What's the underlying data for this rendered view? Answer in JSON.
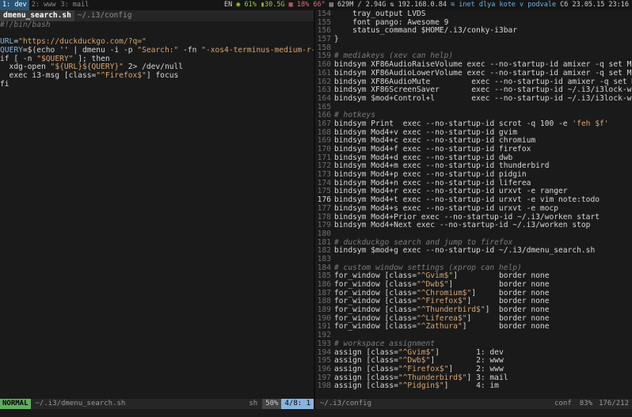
{
  "topbar": {
    "workspaces": [
      {
        "label": "1: dev",
        "active": true
      },
      {
        "label": "2: www",
        "active": false
      },
      {
        "label": "3: mail",
        "active": false
      }
    ],
    "lang": "EN",
    "wifi": "61%",
    "disk": "30.5G",
    "cpu": "18%",
    "temp": "66°",
    "mem": "629M / 2.94G",
    "ip": "192.168.0.84",
    "net": "inet dlya kote v podvale",
    "date": "Сб 23.05.15",
    "time": "23:16"
  },
  "left": {
    "tabs": [
      {
        "label": "dmenu_search.sh",
        "active": true
      },
      {
        "label": "~/.i3/config",
        "active": false
      }
    ],
    "lines": [
      [
        [
          "cmt",
          "#!/bin/bash"
        ]
      ],
      [
        [
          "kw",
          ""
        ]
      ],
      [
        [
          "var",
          "URL"
        ],
        [
          "kw",
          "="
        ],
        [
          "str",
          "\"https://duckduckgo.com/?q=\""
        ]
      ],
      [
        [
          "var",
          "QUERY"
        ],
        [
          "kw",
          "=$(echo '' | dmenu -i -p "
        ],
        [
          "str",
          "\"Search:\""
        ],
        [
          "kw",
          " -fn "
        ],
        [
          "str",
          "\"-xos4-terminus-medium-r-*-*-1"
        ]
      ],
      [
        [
          "kw",
          "if [ -n "
        ],
        [
          "str",
          "\"$QUERY\""
        ],
        [
          "kw",
          " ]; then"
        ]
      ],
      [
        [
          "kw",
          "  xdg-open "
        ],
        [
          "str",
          "\"${URL}${QUERY}\""
        ],
        [
          "kw",
          " 2> /dev/null"
        ]
      ],
      [
        [
          "kw",
          "  exec i3-msg [class="
        ],
        [
          "str",
          "\"^Firefox$\""
        ],
        [
          "kw",
          "] focus"
        ]
      ],
      [
        [
          "kw",
          "fi"
        ]
      ]
    ]
  },
  "right": {
    "lines": [
      {
        "n": "154",
        "parts": [
          [
            "kw",
            "    tray_output LVDS"
          ]
        ]
      },
      {
        "n": "155",
        "parts": [
          [
            "kw",
            "    font pango: Awesome 9"
          ]
        ]
      },
      {
        "n": "156",
        "parts": [
          [
            "kw",
            "    status_command $HOME/.i3/conky-i3bar"
          ]
        ]
      },
      {
        "n": "157",
        "parts": [
          [
            "kw",
            "}"
          ]
        ]
      },
      {
        "n": "158",
        "parts": [
          [
            "kw",
            ""
          ]
        ]
      },
      {
        "n": "159",
        "parts": [
          [
            "cmt",
            "# mediakeys (xev can help)"
          ]
        ]
      },
      {
        "n": "160",
        "parts": [
          [
            "kw",
            "bindsym XF86AudioRaiseVolume exec --no-startup-id amixer -q set Master"
          ]
        ]
      },
      {
        "n": "161",
        "parts": [
          [
            "kw",
            "bindsym XF86AudioLowerVolume exec --no-startup-id amixer -q set Master"
          ]
        ]
      },
      {
        "n": "162",
        "parts": [
          [
            "kw",
            "bindsym XF86AudioMute         exec --no-startup-id amixer -q set Master"
          ]
        ]
      },
      {
        "n": "163",
        "parts": [
          [
            "kw",
            "bindsym XF86ScreenSaver       exec --no-startup-id ~/.i3/i3lock-wrapper"
          ]
        ]
      },
      {
        "n": "164",
        "parts": [
          [
            "kw",
            "bindsym $mod+Control+l        exec --no-startup-id ~/.i3/i3lock-wrapper"
          ]
        ]
      },
      {
        "n": "165",
        "parts": [
          [
            "kw",
            ""
          ]
        ]
      },
      {
        "n": "166",
        "parts": [
          [
            "cmt",
            "# hotkeys"
          ]
        ]
      },
      {
        "n": "167",
        "parts": [
          [
            "kw",
            "bindsym Print  exec --no-startup-id scrot -q 100 -e "
          ],
          [
            "str",
            "'feh $f'"
          ]
        ]
      },
      {
        "n": "168",
        "parts": [
          [
            "kw",
            "bindsym Mod4+v exec --no-startup-id gvim"
          ]
        ]
      },
      {
        "n": "169",
        "parts": [
          [
            "kw",
            "bindsym Mod4+c exec --no-startup-id chromium"
          ]
        ]
      },
      {
        "n": "170",
        "parts": [
          [
            "kw",
            "bindsym Mod4+f exec --no-startup-id firefox"
          ]
        ]
      },
      {
        "n": "171",
        "parts": [
          [
            "kw",
            "bindsym Mod4+d exec --no-startup-id dwb"
          ]
        ]
      },
      {
        "n": "172",
        "parts": [
          [
            "kw",
            "bindsym Mod4+m exec --no-startup-id thunderbird"
          ]
        ]
      },
      {
        "n": "173",
        "parts": [
          [
            "kw",
            "bindsym Mod4+p exec --no-startup-id pidgin"
          ]
        ]
      },
      {
        "n": "174",
        "parts": [
          [
            "kw",
            "bindsym Mod4+n exec --no-startup-id liferea"
          ]
        ]
      },
      {
        "n": "175",
        "parts": [
          [
            "kw",
            "bindsym Mod4+r exec --no-startup-id urxvt -e ranger"
          ]
        ]
      },
      {
        "n": "176",
        "cur": true,
        "parts": [
          [
            "kw",
            "bindsym Mod4+t exec --no-startup-id urxvt -e vim note:todo"
          ]
        ]
      },
      {
        "n": "177",
        "parts": [
          [
            "kw",
            "bindsym Mod4+s exec --no-startup-id urxvt -e mocp"
          ]
        ]
      },
      {
        "n": "178",
        "parts": [
          [
            "kw",
            "bindsym Mod4+Prior exec --no-startup-id ~/.i3/worken start"
          ]
        ]
      },
      {
        "n": "179",
        "parts": [
          [
            "kw",
            "bindsym Mod4+Next exec --no-startup-id ~/.i3/worken stop"
          ]
        ]
      },
      {
        "n": "180",
        "parts": [
          [
            "kw",
            ""
          ]
        ]
      },
      {
        "n": "181",
        "parts": [
          [
            "cmt",
            "# duckduckgo search and jump to firefox"
          ]
        ]
      },
      {
        "n": "182",
        "parts": [
          [
            "kw",
            "bindsym $mod+g exec --no-startup-id ~/.i3/dmenu_search.sh"
          ]
        ]
      },
      {
        "n": "183",
        "parts": [
          [
            "kw",
            ""
          ]
        ]
      },
      {
        "n": "184",
        "parts": [
          [
            "cmt",
            "# custom window settings (xprop can help)"
          ]
        ]
      },
      {
        "n": "185",
        "parts": [
          [
            "kw",
            "for_window [class="
          ],
          [
            "str",
            "\"^Gvim$\""
          ],
          [
            "kw",
            "]         border none"
          ]
        ]
      },
      {
        "n": "186",
        "parts": [
          [
            "kw",
            "for_window [class="
          ],
          [
            "str",
            "\"^Dwb$\""
          ],
          [
            "kw",
            "]          border none"
          ]
        ]
      },
      {
        "n": "187",
        "parts": [
          [
            "kw",
            "for_window [class="
          ],
          [
            "str",
            "\"^Chromium$\""
          ],
          [
            "kw",
            "]     border none"
          ]
        ]
      },
      {
        "n": "188",
        "parts": [
          [
            "kw",
            "for_window [class="
          ],
          [
            "str",
            "\"^Firefox$\""
          ],
          [
            "kw",
            "]      border none"
          ]
        ]
      },
      {
        "n": "189",
        "parts": [
          [
            "kw",
            "for_window [class="
          ],
          [
            "str",
            "\"^Thunderbird$\""
          ],
          [
            "kw",
            "]  border none"
          ]
        ]
      },
      {
        "n": "190",
        "parts": [
          [
            "kw",
            "for_window [class="
          ],
          [
            "str",
            "\"^Liferea$\""
          ],
          [
            "kw",
            "]      border none"
          ]
        ]
      },
      {
        "n": "191",
        "parts": [
          [
            "kw",
            "for_window [class="
          ],
          [
            "str",
            "\"^Zathura\""
          ],
          [
            "kw",
            "]       border none"
          ]
        ]
      },
      {
        "n": "192",
        "parts": [
          [
            "kw",
            ""
          ]
        ]
      },
      {
        "n": "193",
        "parts": [
          [
            "cmt",
            "# workspace assignment"
          ]
        ]
      },
      {
        "n": "194",
        "parts": [
          [
            "kw",
            "assign [class="
          ],
          [
            "str",
            "\"^Gvim$\""
          ],
          [
            "kw",
            "]        1: dev"
          ]
        ]
      },
      {
        "n": "195",
        "parts": [
          [
            "kw",
            "assign [class="
          ],
          [
            "str",
            "\"^Dwb$\""
          ],
          [
            "kw",
            "]         2: www"
          ]
        ]
      },
      {
        "n": "196",
        "parts": [
          [
            "kw",
            "assign [class="
          ],
          [
            "str",
            "\"^Firefox$\""
          ],
          [
            "kw",
            "]     2: www"
          ]
        ]
      },
      {
        "n": "197",
        "parts": [
          [
            "kw",
            "assign [class="
          ],
          [
            "str",
            "\"^Thunderbird$\""
          ],
          [
            "kw",
            "] 3: mail"
          ]
        ]
      },
      {
        "n": "198",
        "parts": [
          [
            "kw",
            "assign [class="
          ],
          [
            "str",
            "\"^Pidgin$\""
          ],
          [
            "kw",
            "]      4: im"
          ]
        ]
      }
    ]
  },
  "statusline_left": {
    "mode": "NORMAL",
    "file": "~/.i3/dmenu_search.sh",
    "ft": "sh",
    "pct": "50%",
    "pos": "4/8: 1"
  },
  "statusline_right": {
    "file": "~/.i3/config",
    "ft": "conf",
    "pct": "83%",
    "pos": "176/212"
  }
}
